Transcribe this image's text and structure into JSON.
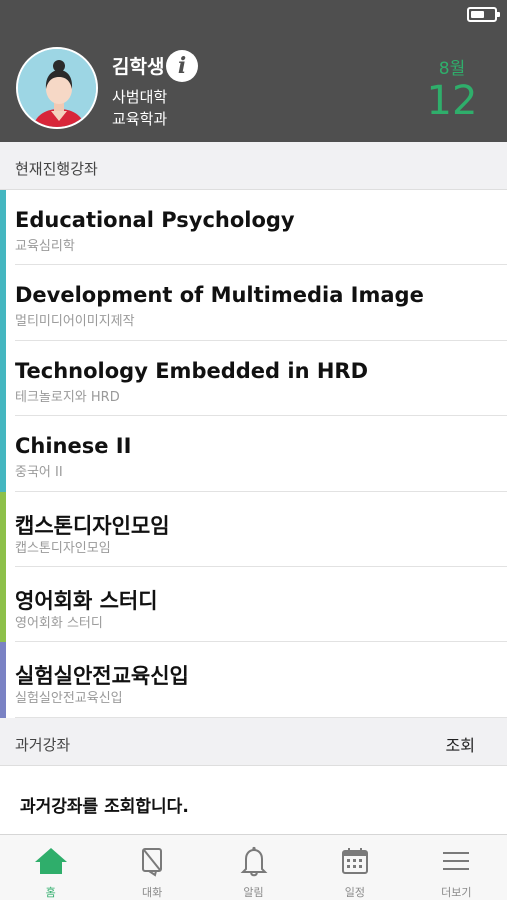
{
  "status_bar": {
    "battery_level": 0.6
  },
  "profile": {
    "name": "김학생",
    "college": "사범대학",
    "department": "교육학과",
    "info_icon": "i"
  },
  "date": {
    "month": "8월",
    "day": "12"
  },
  "current_courses": {
    "title": "현재진행강좌",
    "items": [
      {
        "title": "Educational Psychology",
        "subtitle": "교육심리학",
        "color": "#44b6c0"
      },
      {
        "title": "Development of Multimedia Image",
        "subtitle": "멀티미디어이미지제작",
        "color": "#44b6c0"
      },
      {
        "title": "Technology Embedded in HRD",
        "subtitle": "테크놀로지와 HRD",
        "color": "#44b6c0"
      },
      {
        "title": "Chinese II",
        "subtitle": "중국어 II",
        "color": "#44b6c0"
      },
      {
        "title": "캡스톤디자인모임",
        "subtitle": "캡스톤디자인모임",
        "color": "#8dc04a"
      },
      {
        "title": "영어회화 스터디",
        "subtitle": "영어회화 스터디",
        "color": "#8dc04a"
      },
      {
        "title": "실험실안전교육신입",
        "subtitle": "실험실안전교육신입",
        "color": "#7a82c4"
      }
    ]
  },
  "past_courses": {
    "title": "과거강좌",
    "action": "조회",
    "message": "과거강좌를 조회합니다."
  },
  "tabbar": {
    "items": [
      {
        "label": "홈",
        "icon": "home-icon",
        "active": true
      },
      {
        "label": "대화",
        "icon": "chat-icon",
        "active": false
      },
      {
        "label": "알림",
        "icon": "bell-icon",
        "active": false
      },
      {
        "label": "일정",
        "icon": "calendar-icon",
        "active": false
      },
      {
        "label": "더보기",
        "icon": "menu-icon",
        "active": false
      }
    ]
  },
  "colors": {
    "accent": "#2fae6b",
    "header_bg": "#4f4f4f"
  }
}
